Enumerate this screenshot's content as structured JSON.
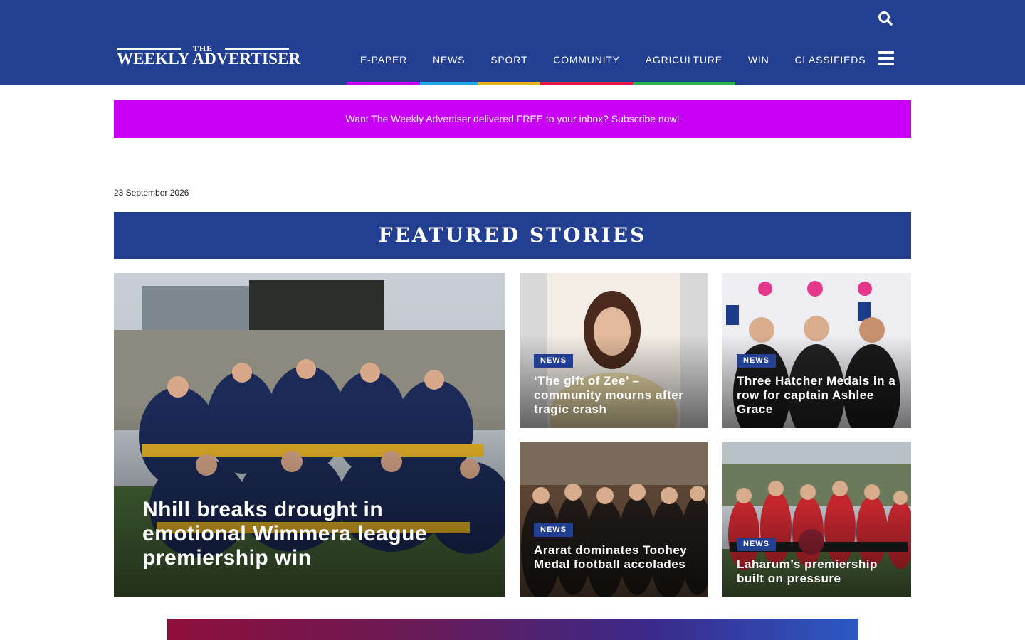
{
  "header": {
    "logo_top": "THE",
    "logo_name": "WEEKLY ADVERTISER",
    "search_icon": "search-icon",
    "menu_icon": "hamburger-menu-icon",
    "background": "#233f91"
  },
  "nav": {
    "items": [
      {
        "label": "E-PAPER",
        "color": "#c800f5"
      },
      {
        "label": "NEWS",
        "color": "#23a9e8"
      },
      {
        "label": "SPORT",
        "color": "#e8b41c"
      },
      {
        "label": "COMMUNITY",
        "color": "#e8174c"
      },
      {
        "label": "AGRICULTURE",
        "color": "#2eb34a"
      },
      {
        "label": "WIN",
        "color": ""
      },
      {
        "label": "CLASSIFIEDS",
        "color": ""
      }
    ]
  },
  "subscribe": {
    "text": "Want The Weekly Advertiser delivered FREE to your inbox? Subscribe now!",
    "color": "#c800f5"
  },
  "date": "23 September 2026",
  "featured": {
    "heading": "FEATURED STORIES",
    "main": {
      "title": "Nhill breaks drought in emotional Wimmera league premiership win"
    },
    "stories": [
      {
        "badge": "NEWS",
        "title": "‘The gift of Zee’ – community mourns after tragic crash"
      },
      {
        "badge": "NEWS",
        "title": "Three Hatcher Medals in a row for captain Ashlee Grace"
      },
      {
        "badge": "NEWS",
        "title": "Ararat dominates Toohey Medal football accolades"
      },
      {
        "badge": "NEWS",
        "title": "Laharum’s premiership built on pressure"
      }
    ]
  }
}
